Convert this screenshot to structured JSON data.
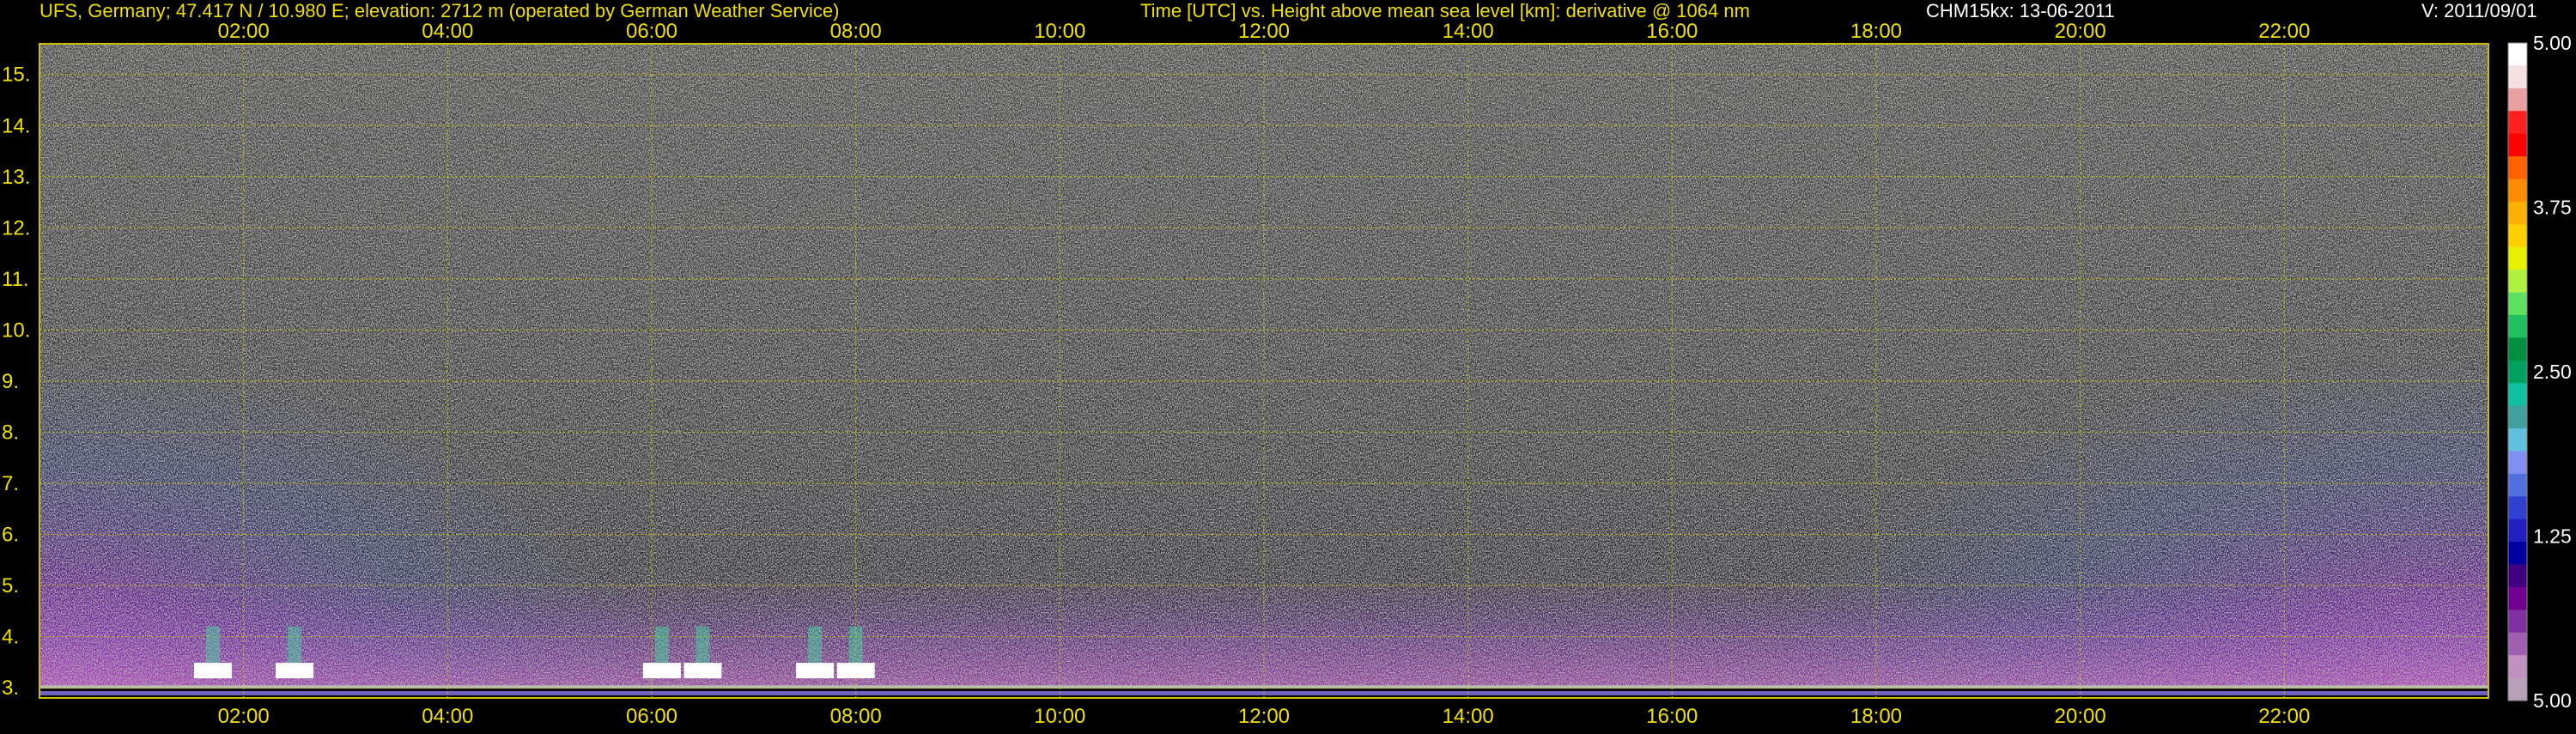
{
  "header": {
    "station": "UFS, Germany; 47.417 N / 10.980 E; elevation: 2712 m  (operated by German Weather Service)",
    "description": "Time [UTC] vs. Height above mean sea level [km]: derivative @ 1064 nm",
    "instrument": "CHM15kx: 13-06-2011",
    "version": "V: 2011/09/01"
  },
  "chart_data": {
    "type": "heatmap",
    "title": "Time [UTC] vs. Height above mean sea level [km]: derivative @ 1064 nm",
    "xlabel": "Time [UTC]",
    "ylabel": "Height above mean sea level [km]",
    "x_ticks": [
      "02:00",
      "04:00",
      "06:00",
      "08:00",
      "10:00",
      "12:00",
      "14:00",
      "16:00",
      "18:00",
      "20:00",
      "22:00"
    ],
    "x_tick_hours": [
      2,
      4,
      6,
      8,
      10,
      12,
      14,
      16,
      18,
      20,
      22
    ],
    "xlim_hours": [
      0,
      24
    ],
    "y_ticks": [
      "3.",
      "4.",
      "5.",
      "6.",
      "7.",
      "8.",
      "9.",
      "10.",
      "11.",
      "12.",
      "13.",
      "14.",
      "15."
    ],
    "y_tick_values": [
      3,
      4,
      5,
      6,
      7,
      8,
      9,
      10,
      11,
      12,
      13,
      14,
      15
    ],
    "ylim_km": [
      2.8,
      15.6
    ],
    "grid": true,
    "colorbar": {
      "labels": [
        "5.00",
        "3.75",
        "2.50",
        "1.25",
        "5.00"
      ],
      "label_values_top_to_bottom": [
        5.0,
        3.75,
        2.5,
        1.25,
        5.0
      ],
      "colors_top_to_bottom": [
        "#ffffff",
        "#f4e0e0",
        "#e8a0a0",
        "#ff2020",
        "#ff0000",
        "#ff6000",
        "#ff8c00",
        "#ffb000",
        "#ffd000",
        "#e8f000",
        "#b0f040",
        "#60e060",
        "#20c060",
        "#009040",
        "#00a060",
        "#10c0a0",
        "#40a0a0",
        "#60c0e0",
        "#8090f0",
        "#5070e0",
        "#3040d0",
        "#2020c0",
        "#0000a0",
        "#400080",
        "#700090",
        "#8030a0",
        "#a060b0",
        "#c090c0",
        "#b8a0b8"
      ]
    },
    "features": {
      "surface_height_km": 3.05,
      "aerosol_layer_top_km_night": 7.5,
      "aerosol_layer_top_km_day": 4.2,
      "bright_returns_hours": [
        1.7,
        2.5,
        6.1,
        6.5,
        7.6,
        8.0
      ]
    }
  }
}
